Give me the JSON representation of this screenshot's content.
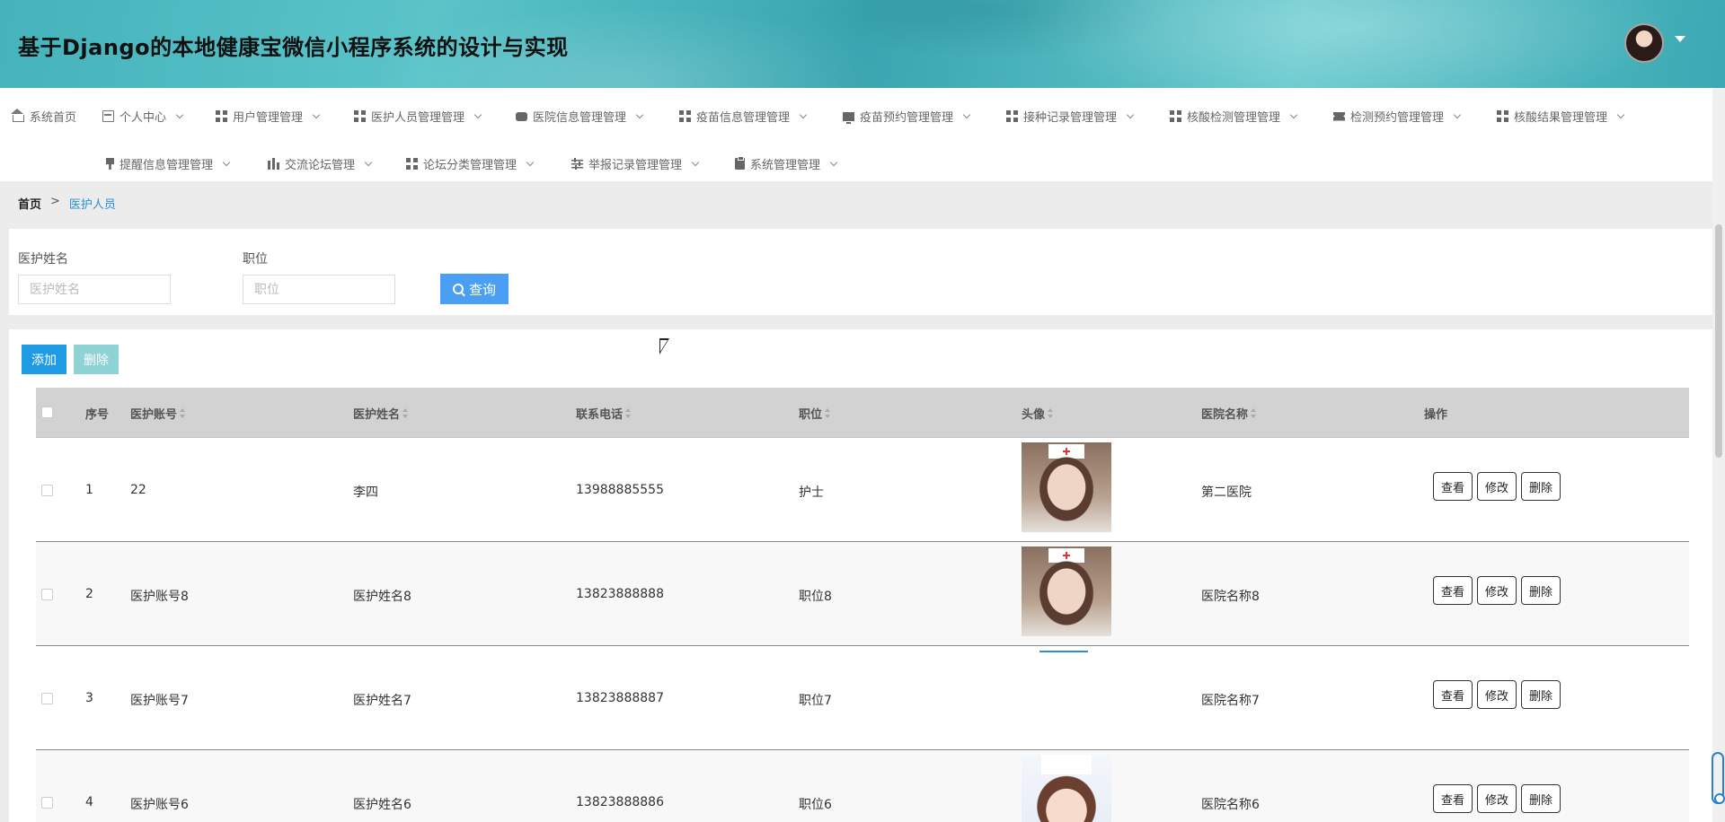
{
  "header": {
    "title": "基于Django的本地健康宝微信小程序系统的设计与实现"
  },
  "nav": {
    "items": [
      {
        "label": "系统首页",
        "icon": "home-icon",
        "dropdown": false
      },
      {
        "label": "个人中心",
        "icon": "card-icon",
        "dropdown": true
      },
      {
        "label": "用户管理管理",
        "icon": "grid-icon",
        "dropdown": true
      },
      {
        "label": "医护人员管理管理",
        "icon": "grid-icon",
        "dropdown": true
      },
      {
        "label": "医院信息管理管理",
        "icon": "chat-icon",
        "dropdown": true
      },
      {
        "label": "疫苗信息管理管理",
        "icon": "grid-icon",
        "dropdown": true
      },
      {
        "label": "疫苗预约管理管理",
        "icon": "monitor-icon",
        "dropdown": true
      },
      {
        "label": "接种记录管理管理",
        "icon": "grid-icon",
        "dropdown": true
      },
      {
        "label": "核酸检测管理管理",
        "icon": "grid-icon",
        "dropdown": true
      },
      {
        "label": "检测预约管理管理",
        "icon": "ticket-icon",
        "dropdown": true
      },
      {
        "label": "核酸结果管理管理",
        "icon": "grid-icon",
        "dropdown": true
      },
      {
        "label": "提醒信息管理管理",
        "icon": "brush-icon",
        "dropdown": true
      },
      {
        "label": "交流论坛管理",
        "icon": "bar-chart-icon",
        "dropdown": true
      },
      {
        "label": "论坛分类管理管理",
        "icon": "grid-icon",
        "dropdown": true
      },
      {
        "label": "举报记录管理管理",
        "icon": "sliders-icon",
        "dropdown": true
      },
      {
        "label": "系统管理管理",
        "icon": "clipboard-icon",
        "dropdown": true
      }
    ]
  },
  "breadcrumb": {
    "home": "首页",
    "separator": ">",
    "current": "医护人员"
  },
  "search": {
    "name_label": "医护姓名",
    "name_placeholder": "医护姓名",
    "name_value": "",
    "position_label": "职位",
    "position_placeholder": "职位",
    "position_value": "",
    "query_label": "查询"
  },
  "actions": {
    "add_label": "添加",
    "delete_label": "删除"
  },
  "table": {
    "columns": [
      "序号",
      "医护账号",
      "医护姓名",
      "联系电话",
      "职位",
      "头像",
      "医院名称",
      "操作"
    ],
    "rows": [
      {
        "index": "1",
        "account": "22",
        "name": "李四",
        "phone": "13988885555",
        "position": "护士",
        "avatar": "nurse-photo",
        "hospital": "第二医院"
      },
      {
        "index": "2",
        "account": "医护账号8",
        "name": "医护姓名8",
        "phone": "13823888888",
        "position": "职位8",
        "avatar": "nurse-photo",
        "hospital": "医院名称8"
      },
      {
        "index": "3",
        "account": "医护账号7",
        "name": "医护姓名7",
        "phone": "13823888887",
        "position": "职位7",
        "avatar": "broken-image",
        "hospital": "医院名称7"
      },
      {
        "index": "4",
        "account": "医护账号6",
        "name": "医护姓名6",
        "phone": "13823888886",
        "position": "职位6",
        "avatar": "cartoon-nurse-photo",
        "hospital": "医院名称6"
      }
    ],
    "row_actions": {
      "view": "查看",
      "edit": "修改",
      "delete": "删除"
    }
  },
  "colors": {
    "header_bg": "#45b3bb",
    "primary_button": "#1e9be3",
    "query_button": "#4a9ff5",
    "disabled_button": "#8fd2d6",
    "breadcrumb_active": "#2a8fd6",
    "table_header_bg": "#d2d2d2"
  }
}
